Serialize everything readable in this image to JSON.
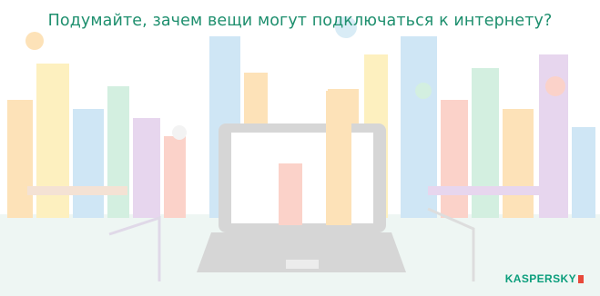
{
  "slide": {
    "question": "Подумайте, зачем вещи могут подключаться к интернету?",
    "brand": "KASPERSKY",
    "colors": {
      "title": "#1e8f6e",
      "brand": "#0b9e7c",
      "laptop": "#d6d6d6",
      "building_blue": "#cfe6f5",
      "building_orange": "#fde2b8",
      "building_yellow": "#fdf0bf",
      "building_red": "#fbd2c9",
      "building_green": "#d3efe0",
      "building_purple": "#e7d6ee"
    },
    "icons": [
      "location-pin-icon",
      "music-note-icon",
      "gear-icon",
      "chat-bubble-icon",
      "cloud-icon",
      "question-icon"
    ]
  }
}
